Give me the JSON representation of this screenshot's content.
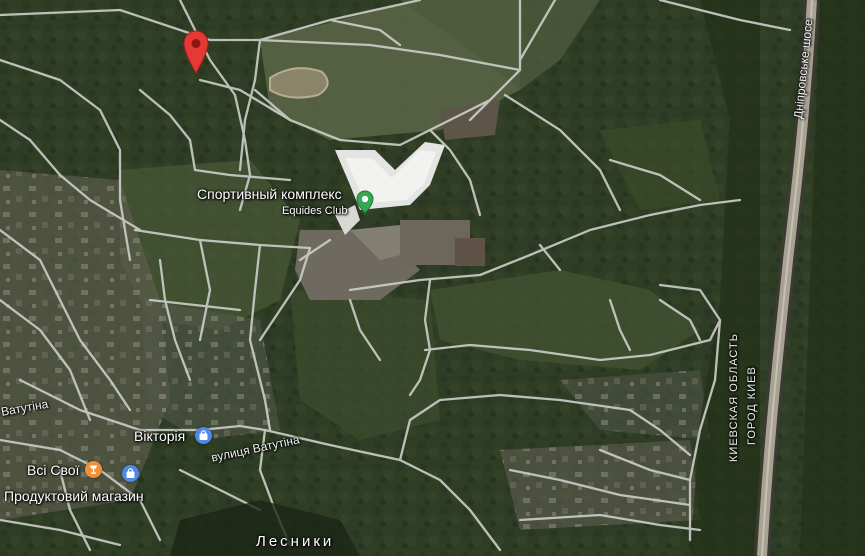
{
  "map": {
    "pois": [
      {
        "name": "Спортивный комплекс",
        "subname": "Equides Club",
        "icon": "sport-pin-icon",
        "color": "#34a853"
      },
      {
        "name": "Вікторія",
        "icon": "shopping-bag-icon",
        "color": "#4f88e8"
      },
      {
        "name": "Всі Свої",
        "icon": "food-icon",
        "color": "#f0913a"
      },
      {
        "name": "Продуктовий магазин",
        "icon": "shopping-bag-icon",
        "color": "#4f88e8"
      }
    ],
    "roads": {
      "vatutina_west": "Ватутіна",
      "vatutina_east": "вулиця Ватутіна",
      "highway": "Дніпровське шосе"
    },
    "district": "Лесники",
    "region_label_1": "КИЕВСКАЯ ОБЛАСТЬ",
    "region_label_2": "ГОРОД КИЕВ",
    "marker_color": "#e53935",
    "marker_icon": "location-pin-icon"
  }
}
